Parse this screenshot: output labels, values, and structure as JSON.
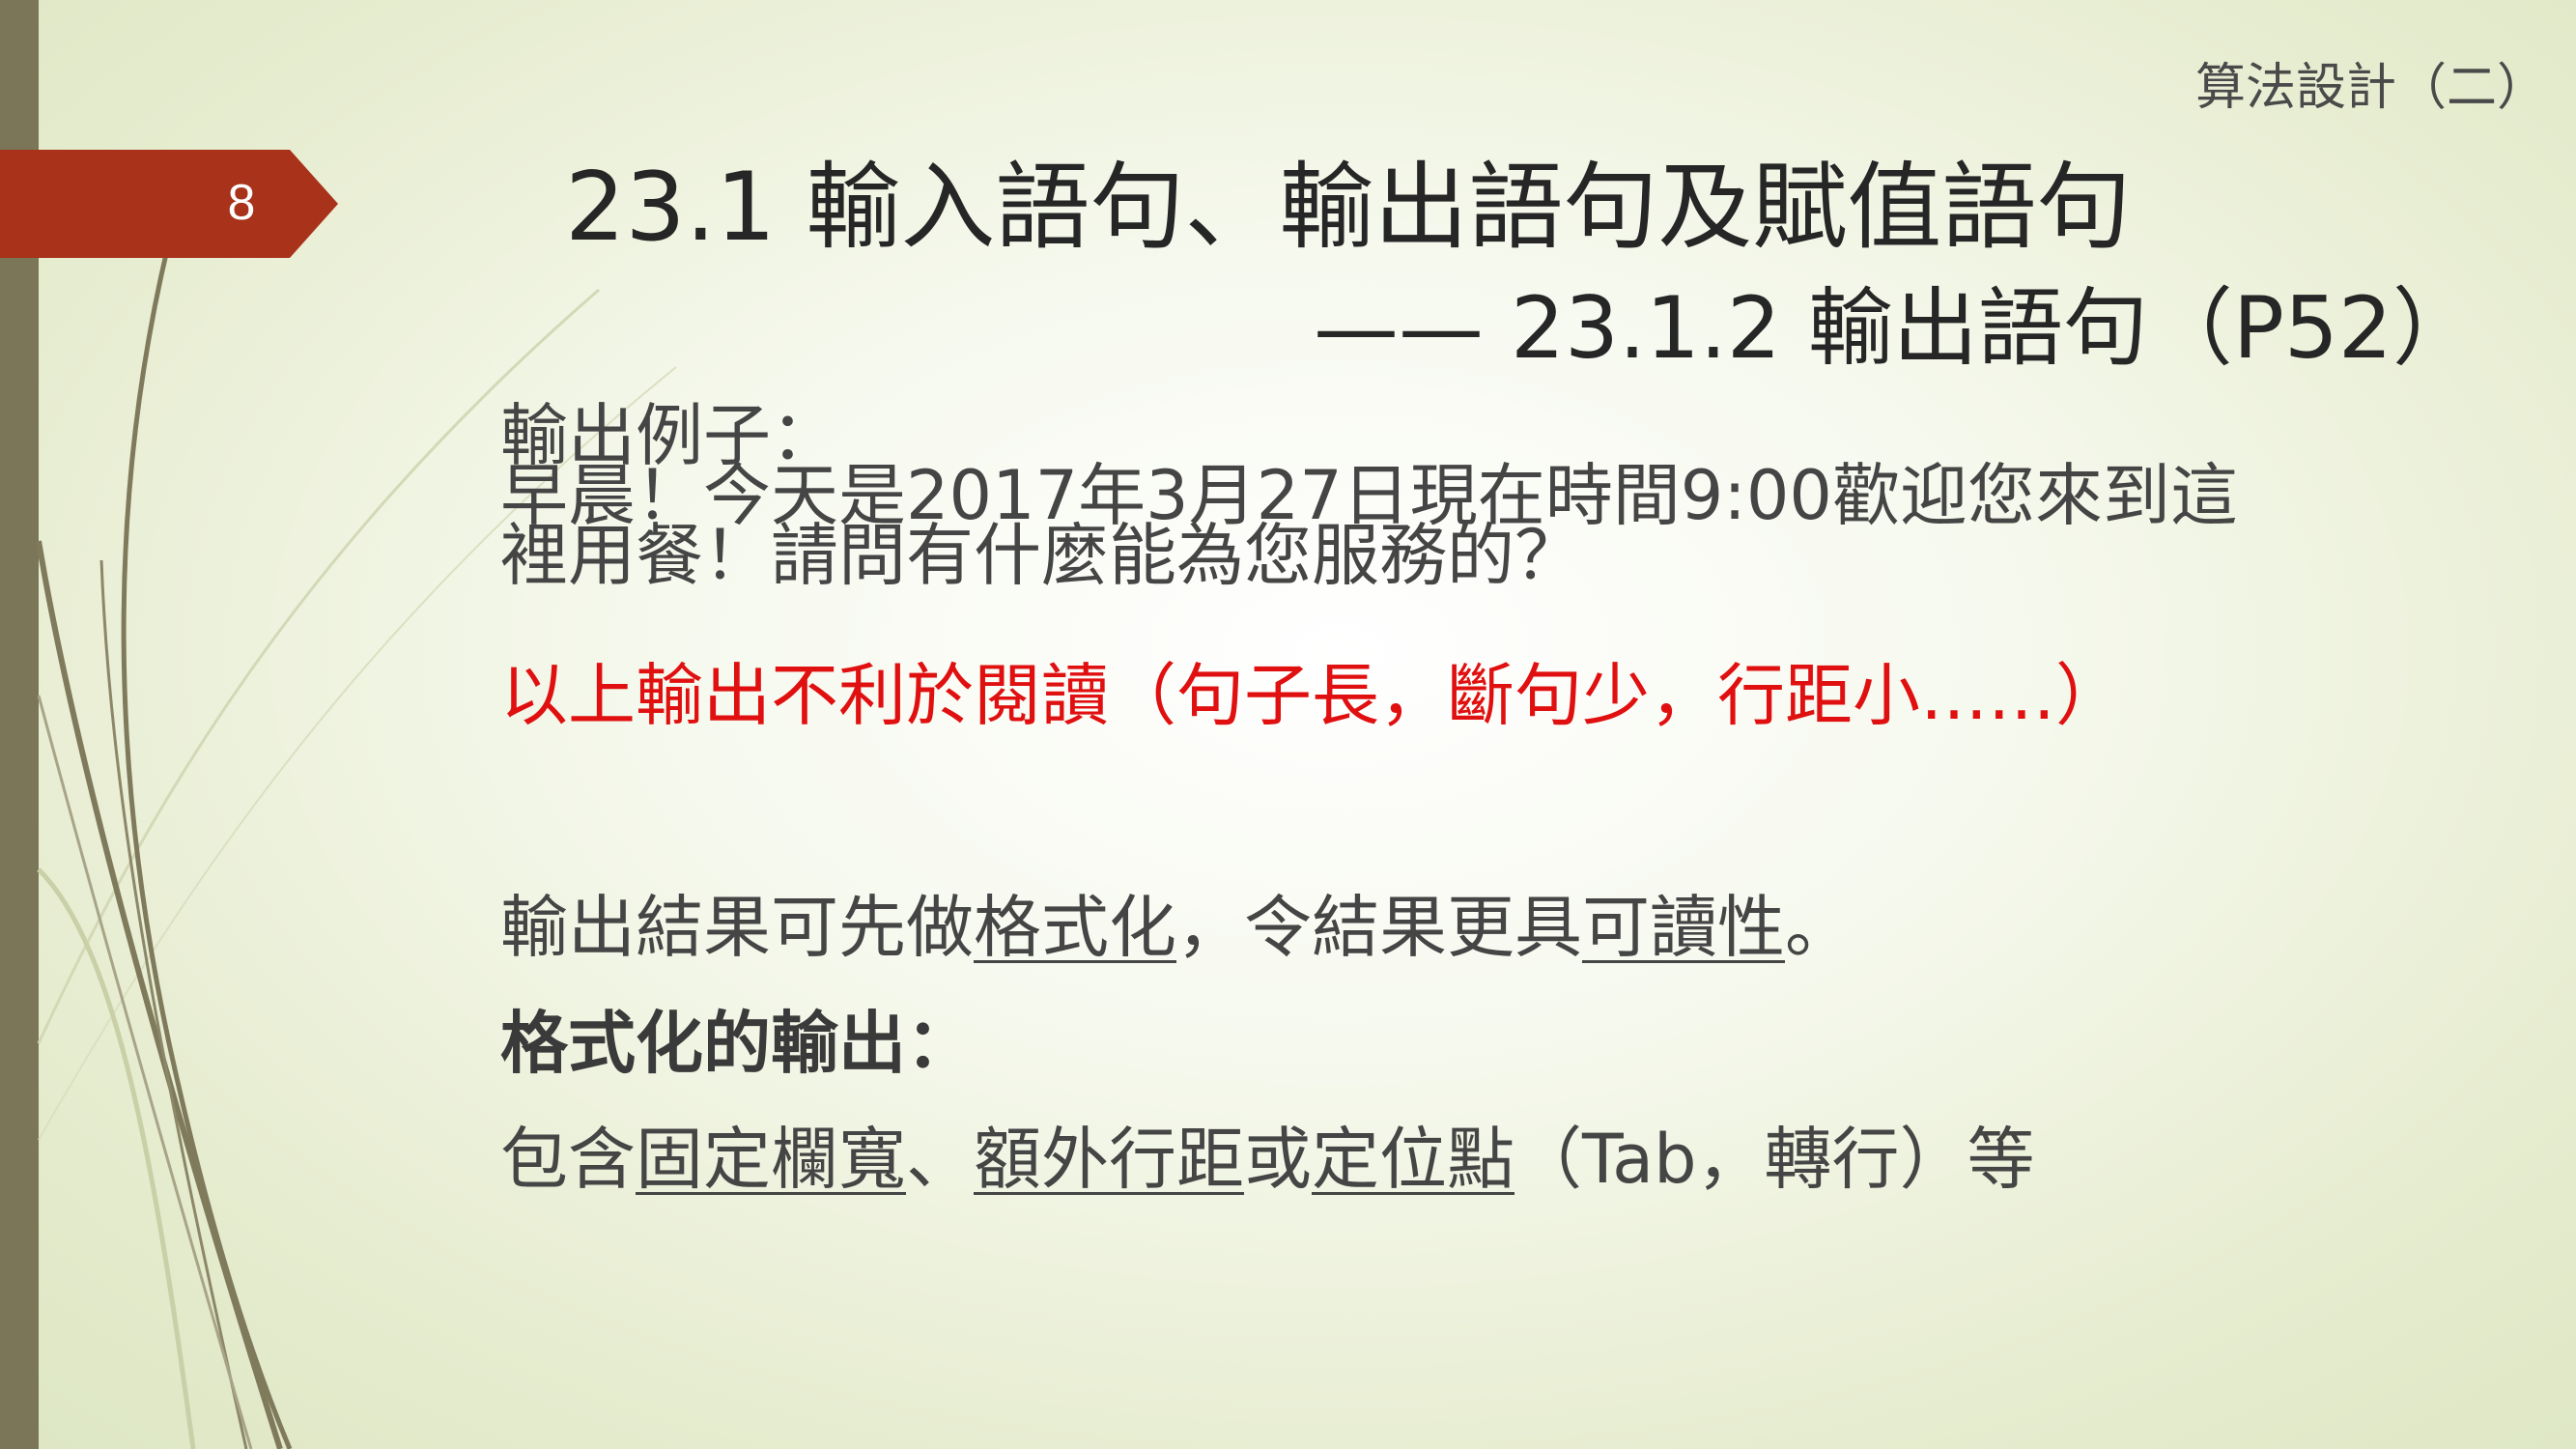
{
  "slide": {
    "number": "8",
    "course_title": "算法設計（二）",
    "title_line1": "23.1 輸入語句、輸出語句及賦值語句",
    "title_line2": "—— 23.1.2 輸出語句（P52）"
  },
  "example": {
    "heading": "輸出例子：",
    "line1": "早晨！今天是2017年3月27日現在時間9:00歡迎您來到這",
    "line2": "裡用餐！請問有什麼能為您服務的？"
  },
  "red_note": "以上輸出不利於閱讀（句子長，斷句少，行距小……）",
  "format_line": {
    "part1": "輸出結果可先做",
    "underline1": "格式化",
    "part2": "，令結果更具",
    "underline2": "可讀性",
    "part3": "。"
  },
  "format_heading": "格式化的輸出：",
  "include_line": {
    "part1": "包含",
    "underline1": "固定欄寬",
    "part2": "、",
    "underline2": "額外行距",
    "part3": "或",
    "underline3": "定位點",
    "part4": "（Tab，轉行）等"
  },
  "colors": {
    "accent_tab": "#a8321a",
    "left_bar": "#7a7657",
    "note_red": "#e01010"
  }
}
